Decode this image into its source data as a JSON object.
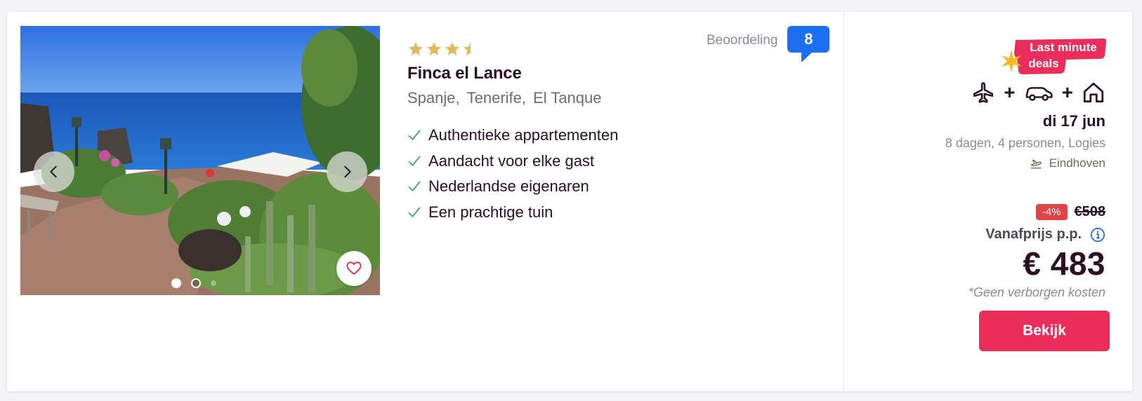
{
  "hotel": {
    "name": "Finca el Lance",
    "stars": 3.5,
    "location": [
      "Spanje,",
      "Tenerife,",
      "El Tanque"
    ],
    "usps": [
      "Authentieke appartementen",
      "Aandacht voor elke gast",
      "Nederlandse eigenaren",
      "Een prachtige tuin"
    ]
  },
  "rating": {
    "label": "Beoordeling",
    "score": "8"
  },
  "gallery": {
    "active_index": 0,
    "dot_count": 3
  },
  "deal": {
    "tag_line1": "Last minute",
    "tag_line2": "deals"
  },
  "trip": {
    "transport_icons": [
      "plane-icon",
      "car-icon",
      "house-icon"
    ],
    "plus": "+",
    "date": "di 17 jun",
    "details": "8 dagen, 4 personen, Logies",
    "airport": "Eindhoven"
  },
  "pricing": {
    "discount": "-4%",
    "old_price": "€508",
    "from_label": "Vanafprijs p.p.",
    "price": "€ 483",
    "no_costs": "*Geen verborgen kosten",
    "button_label": "Bekijk"
  },
  "colors": {
    "accent": "#ea2d5b",
    "rating": "#1c6ff0",
    "check": "#2e9e5b",
    "star": "#e3b75c",
    "discount": "#e04446"
  }
}
